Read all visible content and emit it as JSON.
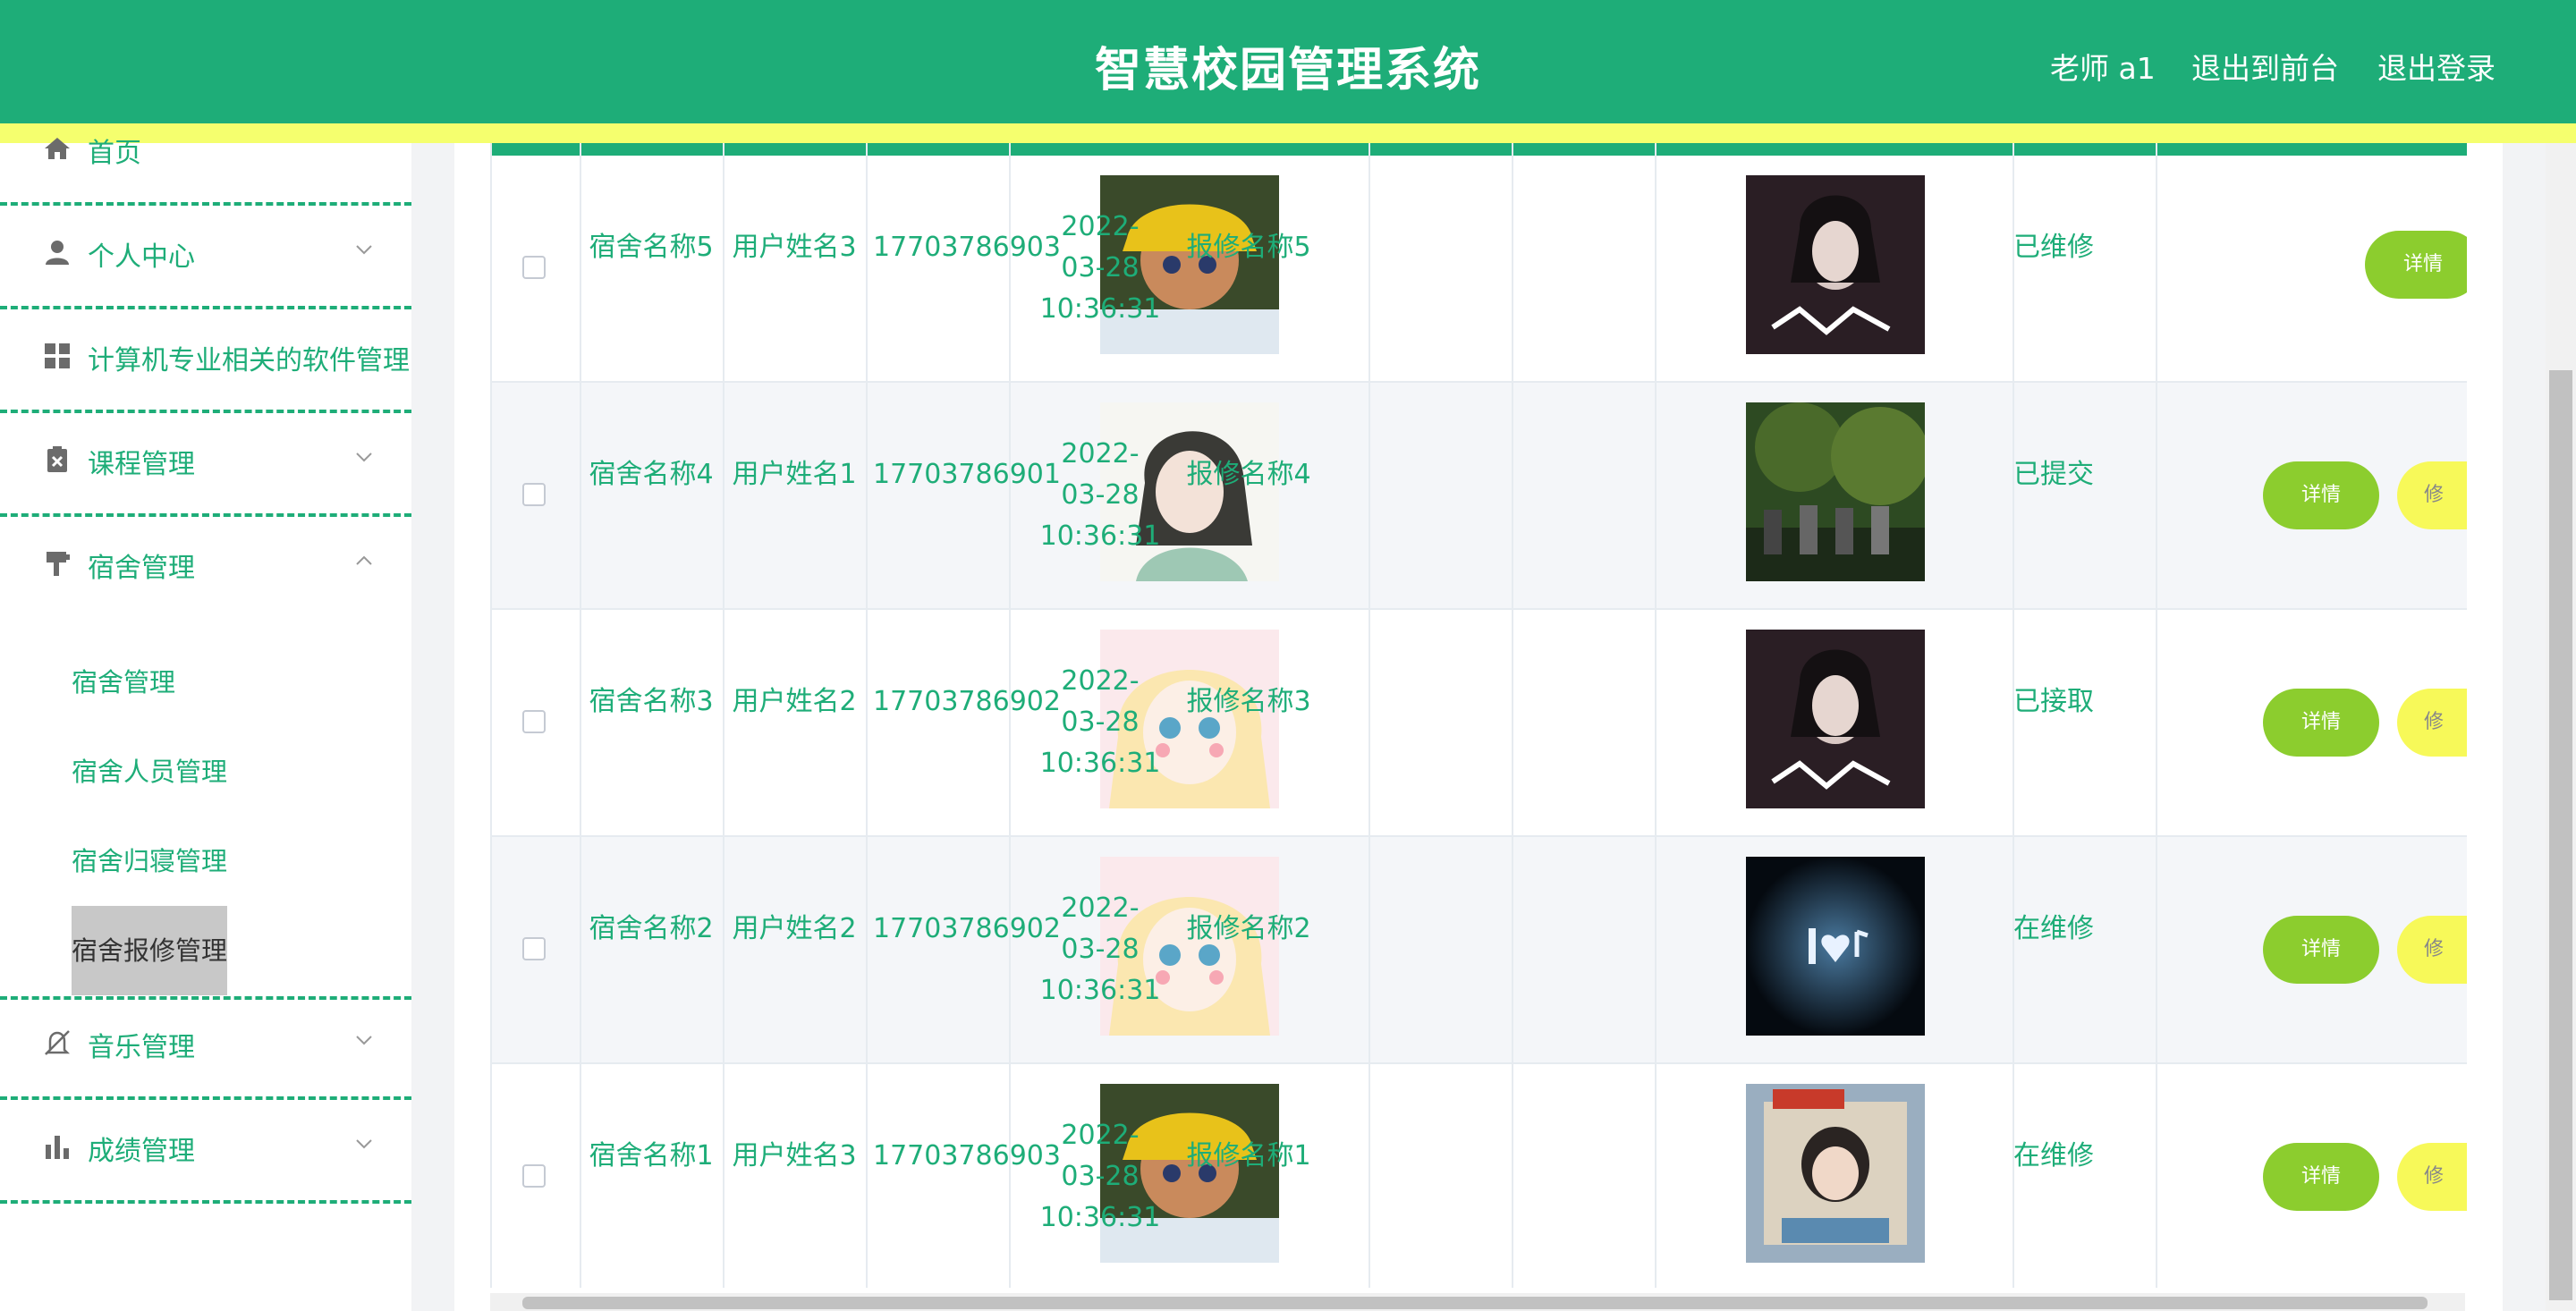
{
  "header": {
    "title": "智慧校园管理系统",
    "user": "老师 a1",
    "to_front": "退出到前台",
    "logout": "退出登录"
  },
  "sidebar": {
    "items": [
      {
        "label": "首页",
        "icon": "home-icon"
      },
      {
        "label": "个人中心",
        "icon": "user-icon"
      },
      {
        "label": "计算机专业相关的软件管理",
        "icon": "grid-icon"
      },
      {
        "label": "课程管理",
        "icon": "clipboard-icon"
      },
      {
        "label": "宿舍管理",
        "icon": "brush-icon"
      },
      {
        "label": "音乐管理",
        "icon": "bell-off-icon"
      },
      {
        "label": "成绩管理",
        "icon": "bar-chart-icon"
      }
    ],
    "sub_items": [
      "宿舍管理",
      "宿舍人员管理",
      "宿舍归寝管理",
      "宿舍报修管理"
    ],
    "active_sub": "宿舍报修管理"
  },
  "table": {
    "rows": [
      {
        "dorm": "宿舍名称5",
        "user": "用户姓名3",
        "phone": "17703786903",
        "time": "2022-03-28 10:36:31",
        "repair": "报修名称5",
        "status": "已维修"
      },
      {
        "dorm": "宿舍名称4",
        "user": "用户姓名1",
        "phone": "17703786901",
        "time": "2022-03-28 10:36:31",
        "repair": "报修名称4",
        "status": "已提交"
      },
      {
        "dorm": "宿舍名称3",
        "user": "用户姓名2",
        "phone": "17703786902",
        "time": "2022-03-28 10:36:31",
        "repair": "报修名称3",
        "status": "已接取"
      },
      {
        "dorm": "宿舍名称2",
        "user": "用户姓名2",
        "phone": "17703786902",
        "time": "2022-03-28 10:36:31",
        "repair": "报修名称2",
        "status": "在维修"
      },
      {
        "dorm": "宿舍名称1",
        "user": "用户姓名3",
        "phone": "17703786903",
        "time": "2022-03-28 10:36:31",
        "repair": "报修名称1",
        "status": "在维修"
      }
    ],
    "detail_label": "详情",
    "edit_label": "修"
  },
  "colors": {
    "primary": "#1ead78",
    "stripe": "#f5ff6e",
    "detail_btn": "#8ccd2e",
    "edit_btn": "#f7f959"
  }
}
